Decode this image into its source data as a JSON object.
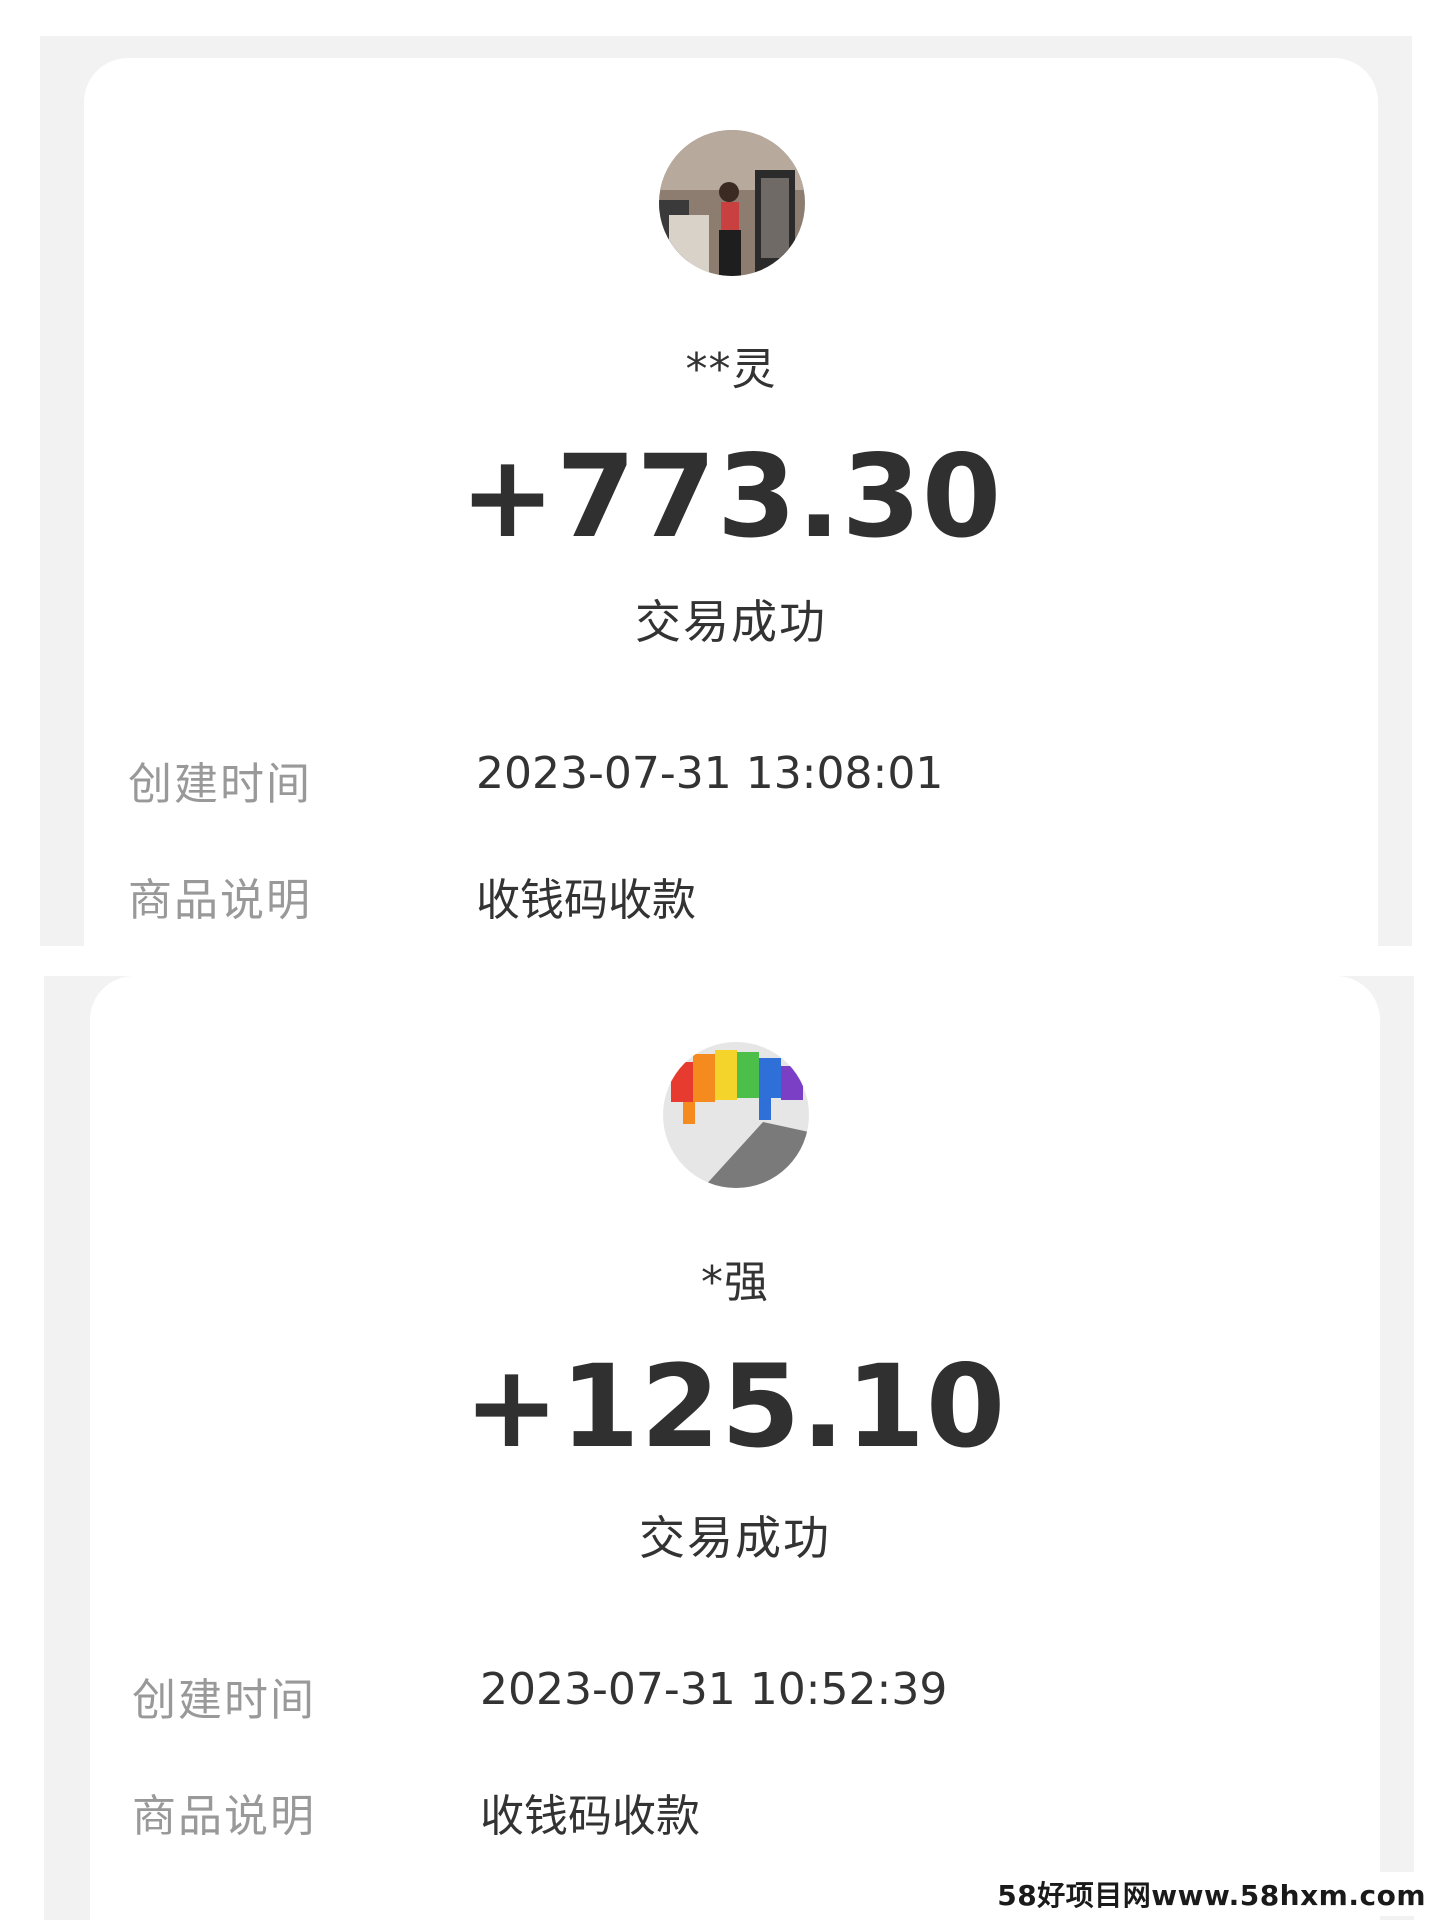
{
  "transactions": [
    {
      "payer_name": "**灵",
      "amount": "+773.30",
      "status": "交易成功",
      "created_label": "创建时间",
      "created_value": "2023-07-31 13:08:01",
      "desc_label": "商品说明",
      "desc_value": "收钱码收款",
      "avatar_icon": "person-photo-avatar"
    },
    {
      "payer_name": "*强",
      "amount": "+125.10",
      "status": "交易成功",
      "created_label": "创建时间",
      "created_value": "2023-07-31 10:52:39",
      "desc_label": "商品说明",
      "desc_value": "收钱码收款",
      "avatar_icon": "rainbow-bear-avatar"
    }
  ],
  "watermark": "58好项目网www.58hxm.com",
  "colors": {
    "background_panel": "#f2f2f2",
    "card": "#ffffff",
    "amount_text": "#303030",
    "label_text": "#999999",
    "value_text": "#333333"
  }
}
